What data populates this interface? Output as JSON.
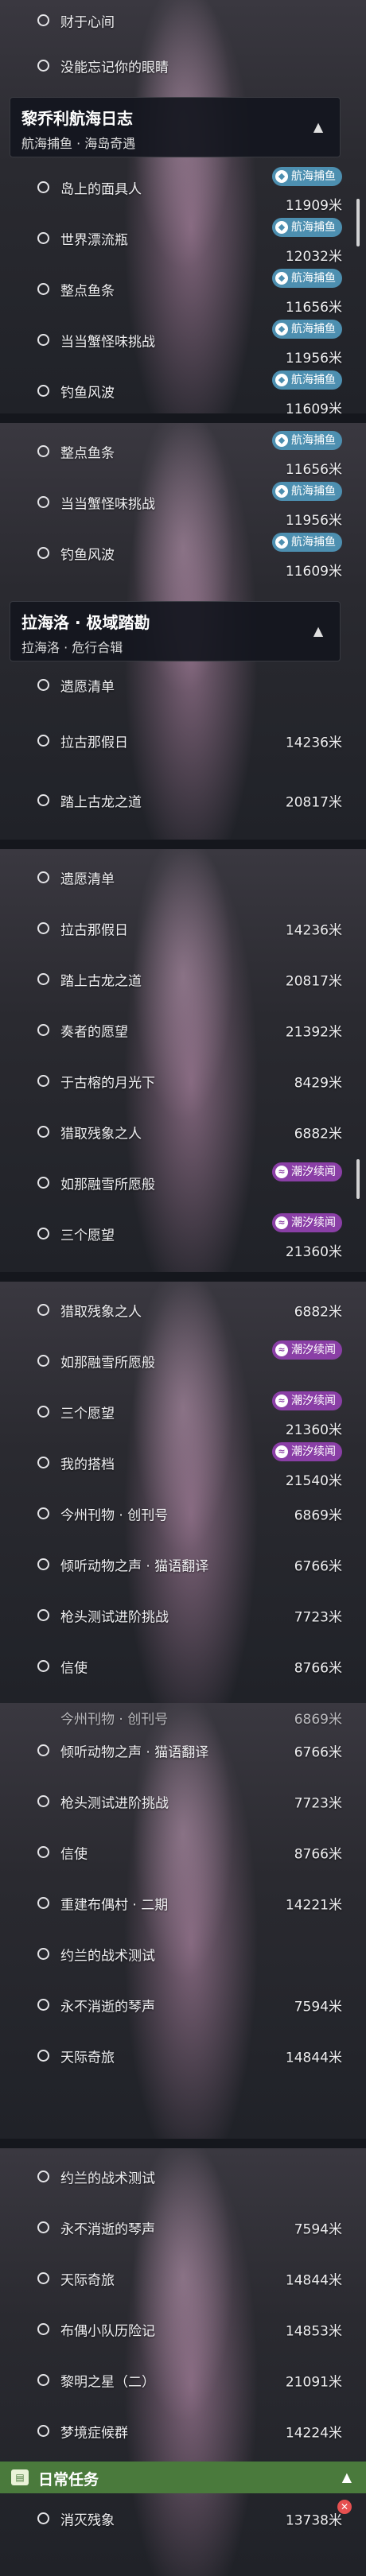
{
  "seg1": {
    "rows_top": [
      {
        "name": "财于心间",
        "dist": ""
      },
      {
        "name": "没能忘记你的眼睛",
        "dist": ""
      }
    ],
    "header": {
      "title": "黎乔利航海日志",
      "subtitle": "航海捕鱼 · 海岛奇遇"
    },
    "rows": [
      {
        "name": "岛上的面具人",
        "dist": "11909米",
        "tag": "航海捕鱼"
      },
      {
        "name": "世界漂流瓶",
        "dist": "12032米",
        "tag": "航海捕鱼"
      },
      {
        "name": "整点鱼条",
        "dist": "11656米",
        "tag": "航海捕鱼"
      },
      {
        "name": "当当蟹怪味挑战",
        "dist": "11956米",
        "tag": "航海捕鱼"
      },
      {
        "name": "钓鱼风波",
        "dist": "11609米",
        "tag": "航海捕鱼"
      }
    ]
  },
  "seg2": {
    "rows": [
      {
        "name": "整点鱼条",
        "dist": "11656米",
        "tag": "航海捕鱼"
      },
      {
        "name": "当当蟹怪味挑战",
        "dist": "11956米",
        "tag": "航海捕鱼"
      },
      {
        "name": "钓鱼风波",
        "dist": "11609米",
        "tag": "航海捕鱼"
      }
    ],
    "header": {
      "title": "拉海洛 · 极域踏勘",
      "subtitle": "拉海洛 · 危行合辑"
    },
    "rows2": [
      {
        "name": "遗愿清单",
        "dist": ""
      },
      {
        "name": "拉古那假日",
        "dist": "14236米"
      },
      {
        "name": "踏上古龙之道",
        "dist": "20817米"
      }
    ]
  },
  "seg3": {
    "rows": [
      {
        "name": "遗愿清单",
        "dist": ""
      },
      {
        "name": "拉古那假日",
        "dist": "14236米"
      },
      {
        "name": "踏上古龙之道",
        "dist": "20817米"
      },
      {
        "name": "奏者的愿望",
        "dist": "21392米"
      },
      {
        "name": "于古榕的月光下",
        "dist": "8429米"
      },
      {
        "name": "猎取残象之人",
        "dist": "6882米"
      },
      {
        "name": "如那融雪所愿般",
        "dist": "",
        "tag": "潮汐续闻"
      },
      {
        "name": "三个愿望",
        "dist": "21360米",
        "tag": "潮汐续闻"
      }
    ]
  },
  "seg4": {
    "rows": [
      {
        "name": "猎取残象之人",
        "dist": "6882米"
      },
      {
        "name": "如那融雪所愿般",
        "dist": "",
        "tag": "潮汐续闻"
      },
      {
        "name": "三个愿望",
        "dist": "21360米",
        "tag": "潮汐续闻"
      },
      {
        "name": "我的搭档",
        "dist": "21540米",
        "tag": "潮汐续闻"
      },
      {
        "name": "今州刊物 · 创刊号",
        "dist": "6869米"
      },
      {
        "name": "倾听动物之声 · 猫语翻译",
        "dist": "6766米"
      },
      {
        "name": "枪头测试进阶挑战",
        "dist": "7723米"
      },
      {
        "name": "信使",
        "dist": "8766米"
      }
    ]
  },
  "seg5": {
    "partial_top": {
      "name": "今州刊物 · 创刊号",
      "dist": "6869米"
    },
    "rows": [
      {
        "name": "倾听动物之声 · 猫语翻译",
        "dist": "6766米"
      },
      {
        "name": "枪头测试进阶挑战",
        "dist": "7723米"
      },
      {
        "name": "信使",
        "dist": "8766米"
      },
      {
        "name": "重建布偶村 · 二期",
        "dist": "14221米"
      },
      {
        "name": "约兰的战术测试",
        "dist": ""
      },
      {
        "name": "永不消逝的琴声",
        "dist": "7594米"
      },
      {
        "name": "天际奇旅",
        "dist": "14844米"
      }
    ]
  },
  "seg6": {
    "rows": [
      {
        "name": "约兰的战术测试",
        "dist": ""
      },
      {
        "name": "永不消逝的琴声",
        "dist": "7594米"
      },
      {
        "name": "天际奇旅",
        "dist": "14844米"
      },
      {
        "name": "布偶小队历险记",
        "dist": "14853米"
      },
      {
        "name": "黎明之星（二）",
        "dist": "21091米"
      },
      {
        "name": "梦境症候群",
        "dist": "14224米"
      }
    ],
    "daily": {
      "label": "日常任务"
    },
    "last": {
      "name": "消灭残象",
      "dist": "13738米"
    }
  },
  "colors": {
    "fish_tag": "#4d8fb0",
    "story_tag": "#8a3fa6",
    "daily_bar": "#4a7a3c"
  }
}
